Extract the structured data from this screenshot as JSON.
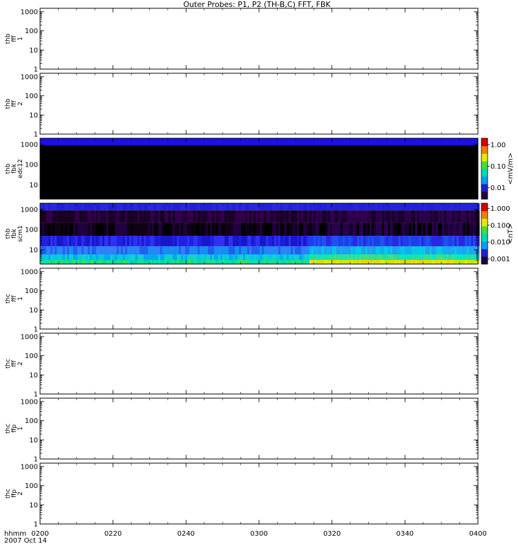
{
  "chart_data": {
    "type": "heatmap",
    "title": "Outer Probes: P1, P2 (TH-B,C) FFT, FBK",
    "time_axis": {
      "label": "hhmm",
      "date": "2007 Oct 14",
      "ticks": [
        "0200",
        "0220",
        "0240",
        "0300",
        "0320",
        "0340",
        "0400"
      ],
      "range": [
        "02:00",
        "04:00"
      ]
    },
    "panels": [
      {
        "label_lines": [
          "thb",
          "fff",
          "1"
        ],
        "yscale": "log",
        "ylim": [
          1,
          1500
        ],
        "yticks": [
          "1",
          "10",
          "100",
          "1000"
        ],
        "has_data": false
      },
      {
        "label_lines": [
          "thb",
          "fff",
          "2"
        ],
        "yscale": "log",
        "ylim": [
          1,
          1500
        ],
        "yticks": [
          "1",
          "10",
          "100",
          "1000"
        ],
        "has_data": false
      },
      {
        "label_lines": [
          "thb",
          "fbk",
          "edc12"
        ],
        "yscale": "log",
        "ylim": [
          2,
          2000
        ],
        "yticks": [
          "10",
          "100",
          "1000"
        ],
        "has_data": true,
        "colorbar": {
          "label": "<mV/m>",
          "ticks": [
            "0.01",
            "0.10",
            "1.00"
          ],
          "range": [
            0.003,
            2
          ]
        }
      },
      {
        "label_lines": [
          "thb",
          "fbk",
          "scm1"
        ],
        "yscale": "log",
        "ylim": [
          2,
          2000
        ],
        "yticks": [
          "10",
          "100",
          "1000"
        ],
        "has_data": true,
        "colorbar": {
          "label": "<nT>",
          "ticks": [
            "0.001",
            "0.010",
            "0.100",
            "1.000"
          ],
          "range": [
            0.0005,
            2
          ]
        }
      },
      {
        "label_lines": [
          "thc",
          "fff",
          "1"
        ],
        "yscale": "log",
        "ylim": [
          1,
          1500
        ],
        "yticks": [
          "1",
          "10",
          "100",
          "1000"
        ],
        "has_data": false
      },
      {
        "label_lines": [
          "thc",
          "fff",
          "2"
        ],
        "yscale": "log",
        "ylim": [
          1,
          1500
        ],
        "yticks": [
          "1",
          "10",
          "100",
          "1000"
        ],
        "has_data": false
      },
      {
        "label_lines": [
          "thc",
          "ffp",
          "1"
        ],
        "yscale": "log",
        "ylim": [
          1,
          1500
        ],
        "yticks": [
          "1",
          "10",
          "100",
          "1000"
        ],
        "has_data": false
      },
      {
        "label_lines": [
          "thc",
          "ffp",
          "2"
        ],
        "yscale": "log",
        "ylim": [
          1,
          1500
        ],
        "yticks": [
          "1",
          "10",
          "100",
          "1000"
        ],
        "has_data": false
      }
    ],
    "colors": {
      "edc12_top_band": "#1c10e6",
      "edc12_body": "#000000",
      "scm1_low_freq": "#e8e800",
      "scm1_mid_freq": "#00e0c0",
      "scm1_high_freq": "#2020e0"
    },
    "grid": false,
    "legend": "none"
  }
}
